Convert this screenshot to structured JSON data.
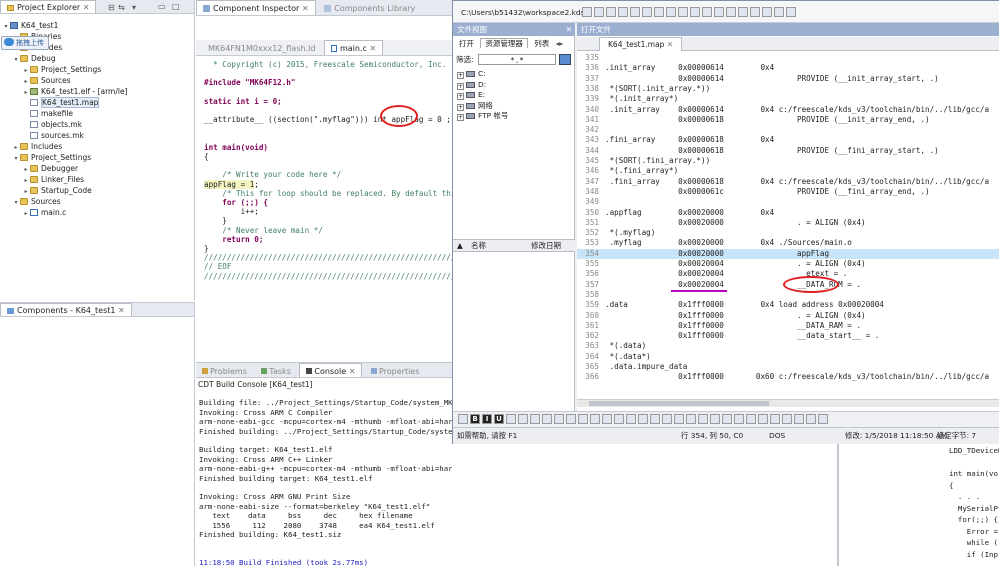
{
  "project_explorer": {
    "tab_label": "Project Explorer",
    "tree": [
      {
        "label": "K64_test1",
        "indent": 0,
        "icon": "proj",
        "twisty": "▾"
      },
      {
        "label": "Binaries",
        "indent": 1,
        "icon": "folder",
        "twisty": "▸"
      },
      {
        "label": "Includes",
        "indent": 1,
        "icon": "folder",
        "twisty": "▸"
      },
      {
        "label": "Debug",
        "indent": 1,
        "icon": "folder",
        "twisty": "▾"
      },
      {
        "label": "Project_Settings",
        "indent": 2,
        "icon": "folder",
        "twisty": "▸"
      },
      {
        "label": "Sources",
        "indent": 2,
        "icon": "folder",
        "twisty": "▸"
      },
      {
        "label": "K64_test1.elf - [arm/le]",
        "indent": 2,
        "icon": "elf",
        "twisty": "▸"
      },
      {
        "label": "K64_test1.map",
        "indent": 2,
        "icon": "file",
        "twisty": ""
      },
      {
        "label": "makefile",
        "indent": 2,
        "icon": "file",
        "twisty": ""
      },
      {
        "label": "objects.mk",
        "indent": 2,
        "icon": "file",
        "twisty": ""
      },
      {
        "label": "sources.mk",
        "indent": 2,
        "icon": "file",
        "twisty": ""
      },
      {
        "label": "Includes",
        "indent": 1,
        "icon": "folder",
        "twisty": "▸"
      },
      {
        "label": "Project_Settings",
        "indent": 1,
        "icon": "folder",
        "twisty": "▾"
      },
      {
        "label": "Debugger",
        "indent": 2,
        "icon": "folder",
        "twisty": "▸"
      },
      {
        "label": "Linker_Files",
        "indent": 2,
        "icon": "folder",
        "twisty": "▸"
      },
      {
        "label": "Startup_Code",
        "indent": 2,
        "icon": "folder",
        "twisty": "▸"
      },
      {
        "label": "Sources",
        "indent": 1,
        "icon": "folder",
        "twisty": "▾"
      },
      {
        "label": "main.c",
        "indent": 2,
        "icon": "c",
        "twisty": "▸"
      }
    ],
    "upload_tooltip": "拖拽上传"
  },
  "components_panel": {
    "tab_label": "Components - K64_test1"
  },
  "editor": {
    "top_tabs": [
      "Component Inspector",
      "Components Library"
    ],
    "file_tabs": [
      "MK64FN1M0xxx12_flash.ld",
      "main.c"
    ],
    "lines": [
      {
        "t": "  * Copyright (c) 2015, Freescale Semiconductor, Inc.",
        "c": "cm"
      },
      {
        "t": "",
        "c": ""
      },
      {
        "t": "#include \"MK64F12.h\"",
        "c": "kw"
      },
      {
        "t": "",
        "c": ""
      },
      {
        "t": "static int i = 0;",
        "c": "kw"
      },
      {
        "t": "",
        "c": ""
      },
      {
        "t": "__attribute__ ((section(\".myflag\"))) int appFlag = 0 ;",
        "c": ""
      },
      {
        "t": "",
        "c": ""
      },
      {
        "t": "",
        "c": ""
      },
      {
        "t": "int main(void)",
        "c": "kw"
      },
      {
        "t": "{",
        "c": ""
      },
      {
        "t": "",
        "c": ""
      },
      {
        "t": "    /* Write your code here */",
        "c": "cm"
      },
      {
        "t": "appFlag = 1;",
        "c": ""
      },
      {
        "t": "    /* This for loop should be replaced. By default thi",
        "c": "cm"
      },
      {
        "t": "    for (;;) {",
        "c": "kw"
      },
      {
        "t": "        i++;",
        "c": ""
      },
      {
        "t": "    }",
        "c": ""
      },
      {
        "t": "    /* Never leave main */",
        "c": "cm"
      },
      {
        "t": "    return 0;",
        "c": "kw"
      },
      {
        "t": "}",
        "c": ""
      },
      {
        "t": "////////////////////////////////////////////////////////////",
        "c": "cm"
      },
      {
        "t": "// EOF",
        "c": "cm"
      },
      {
        "t": "////////////////////////////////////////////////////////////",
        "c": "cm"
      }
    ]
  },
  "console": {
    "tabs": [
      "Problems",
      "Tasks",
      "Console",
      "Properties"
    ],
    "title": "CDT Build Console [K64_test1]",
    "lines": [
      "",
      "Building file: ../Project_Settings/Startup_Code/system_MK64",
      "Invoking: Cross ARM C Compiler",
      "arm-none-eabi-gcc -mcpu=cortex-m4 -mthumb -mfloat-abi=hard",
      "Finished building: ../Project_Settings/Startup_Code/system_",
      "",
      "Building target: K64_test1.elf",
      "Invoking: Cross ARM C++ Linker",
      "arm-none-eabi-g++ -mcpu=cortex-m4 -mthumb -mfloat-abi=hard -mfpu=fpv4-sp-d16 -O0 -fmessage-length=0 -fsigned-char -ffunction-section",
      "Finished building target: K64_test1.elf",
      "",
      "Invoking: Cross ARM GNU Print Size",
      "arm-none-eabi-size --format=berkeley \"K64_test1.elf\"",
      "   text    data     bss     dec     hex filename",
      "   1556     112    2080    3748     ea4 K64_test1.elf",
      "Finished building: K64_test1.siz",
      "",
      "",
      "11:18:50 Build Finished (took 2s.77ms)"
    ]
  },
  "notepad": {
    "title_path": "C:\\Users\\b51432\\workspace2.kds\\",
    "file_view_label": "文件视图",
    "open_file_label": "打开文件",
    "pane_tabs": [
      "打开",
      "资源管理器",
      "列表"
    ],
    "filter_label": "筛选:",
    "filter_value": "*.*",
    "drives": [
      "C:",
      "D:",
      "E:",
      "网络",
      "FTP 帐号"
    ],
    "col_name": "名称",
    "col_modified": "修改日期",
    "doc_tab": "K64_test1.map",
    "map_lines": [
      {
        "n": "335",
        "t": ""
      },
      {
        "n": "336",
        "t": ".init_array     0x00000614        0x4"
      },
      {
        "n": "337",
        "t": "                0x00000614                PROVIDE (__init_array_start, .)"
      },
      {
        "n": "338",
        "t": " *(SORT(.init_array.*))"
      },
      {
        "n": "339",
        "t": " *(.init_array*)"
      },
      {
        "n": "340",
        "t": " .init_array    0x00000614        0x4 c:/freescale/kds_v3/toolchain/bin/../lib/gcc/a"
      },
      {
        "n": "341",
        "t": "                0x00000618                PROVIDE (__init_array_end, .)"
      },
      {
        "n": "342",
        "t": ""
      },
      {
        "n": "343",
        "t": ".fini_array     0x00000618        0x4"
      },
      {
        "n": "344",
        "t": "                0x00000618                PROVIDE (__fini_array_start, .)"
      },
      {
        "n": "345",
        "t": " *(SORT(.fini_array.*))"
      },
      {
        "n": "346",
        "t": " *(.fini_array*)"
      },
      {
        "n": "347",
        "t": " .fini_array    0x00000618        0x4 c:/freescale/kds_v3/toolchain/bin/../lib/gcc/a"
      },
      {
        "n": "348",
        "t": "                0x0000061c                PROVIDE (__fini_array_end, .)"
      },
      {
        "n": "349",
        "t": ""
      },
      {
        "n": "350",
        "t": ".appflag        0x00020000        0x4"
      },
      {
        "n": "351",
        "t": "                0x00020000                . = ALIGN (0x4)"
      },
      {
        "n": "352",
        "t": " *(.myflag)"
      },
      {
        "n": "353",
        "t": " .myflag        0x00020000        0x4 ./Sources/main.o"
      },
      {
        "n": "354",
        "t": "                0x00020000                appFlag"
      },
      {
        "n": "355",
        "t": "                0x00020004                . = ALIGN (0x4)"
      },
      {
        "n": "356",
        "t": "                0x00020004                __etext = ."
      },
      {
        "n": "357",
        "t": "                0x00020004                __DATA_ROM = ."
      },
      {
        "n": "358",
        "t": ""
      },
      {
        "n": "359",
        "t": ".data           0x1fff0000        0x4 load address 0x00020004"
      },
      {
        "n": "360",
        "t": "                0x1fff0000                . = ALIGN (0x4)"
      },
      {
        "n": "361",
        "t": "                0x1fff0000                __DATA_RAM = ."
      },
      {
        "n": "362",
        "t": "                0x1fff0000                __data_start__ = ."
      },
      {
        "n": "363",
        "t": " *(.data)"
      },
      {
        "n": "364",
        "t": " *(.data*)"
      },
      {
        "n": "365",
        "t": " .data.impure_data"
      },
      {
        "n": "366",
        "t": "                0x1fff0000       0x60 c:/freescale/kds_v3/toolchain/bin/../lib/gcc/a"
      }
    ],
    "status": {
      "help": "如需帮助, 请按 F1",
      "pos": "行 354, 列 50, C0",
      "mode": "DOS",
      "modified": "修改: 1/5/2018 11:18:50 AM",
      "selected": "选定字节: 7"
    }
  },
  "right_code": {
    "lines": [
      "LDD_TDeviceD",
      "",
      "int main(vo",
      "{",
      "  . . .",
      "  MySerialPt",
      "  for(;;) {",
      "    Error =",
      "    while (!",
      "    if (Inp"
    ]
  },
  "colors": {
    "highlight_row": "#c8e4f8",
    "annotation_red": "#e02020",
    "underline_purple": "#c000c0",
    "selection_blue": "#3875d7"
  }
}
